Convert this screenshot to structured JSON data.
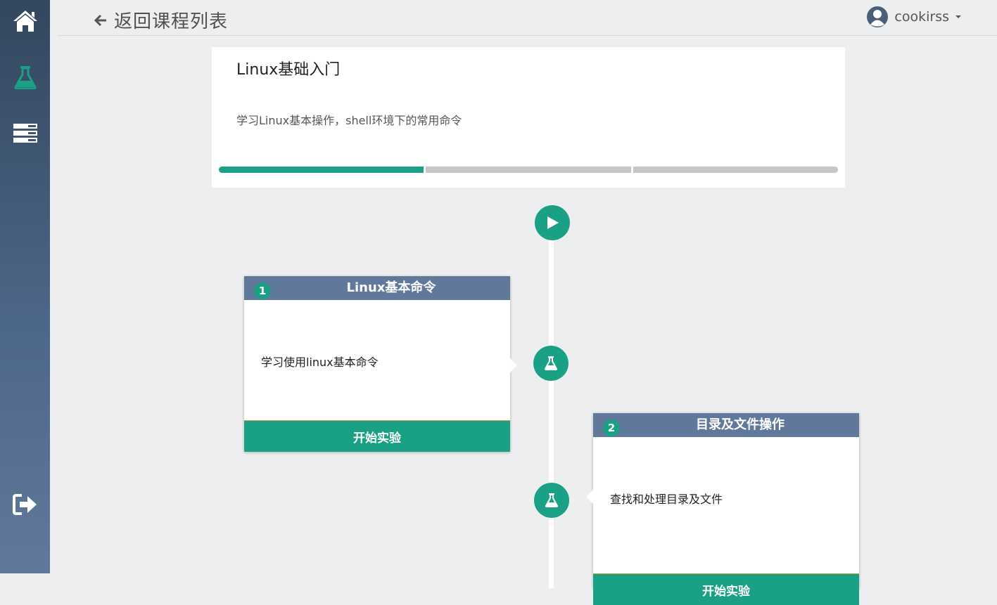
{
  "nav": {
    "back_label": "返回课程列表",
    "username": "cookirss"
  },
  "sidebar": {
    "items": [
      {
        "icon": "home-icon"
      },
      {
        "icon": "flask-icon",
        "active_color": "#1aa085"
      },
      {
        "icon": "server-icon"
      }
    ],
    "logout_icon": "sign-out-icon"
  },
  "course": {
    "title": "Linux基础入门",
    "description": "学习Linux基本操作，shell环境下的常用命令",
    "progress": {
      "completed_segments": 1,
      "total_segments": 3
    }
  },
  "labs": [
    {
      "number": "1",
      "title": "Linux基本命令",
      "description": "学习使用linux基本命令",
      "button": "开始实验"
    },
    {
      "number": "2",
      "title": "目录及文件操作",
      "description": "查找和处理目录及文件",
      "button": "开始实验"
    }
  ],
  "colors": {
    "accent": "#1aa085",
    "header": "#60799a",
    "sidebar": "#33475e",
    "background": "#edeeef"
  }
}
